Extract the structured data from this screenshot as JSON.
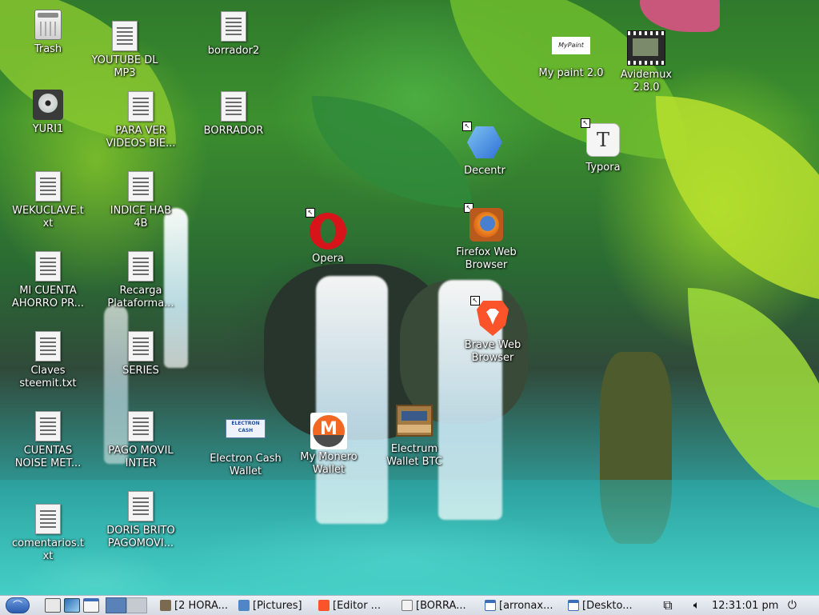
{
  "desktop": {
    "icons": [
      {
        "label": "Trash"
      },
      {
        "label": "YURI1"
      },
      {
        "label": "WEKUCLAVE.t\nxt"
      },
      {
        "label": "MI CUENTA\nAHORRO PR..."
      },
      {
        "label": "Claves\nsteemit.txt"
      },
      {
        "label": "CUENTAS\nNOISE MET..."
      },
      {
        "label": "comentarios.t\nxt"
      },
      {
        "label": "YOUTUBE DL\nMP3"
      },
      {
        "label": "PARA VER\nVIDEOS BIE..."
      },
      {
        "label": "INDICE HAB\n4B"
      },
      {
        "label": "Recarga\nPlataforma..."
      },
      {
        "label": "SERIES"
      },
      {
        "label": "PAGO MOVIL\nINTER"
      },
      {
        "label": "DORIS BRITO\nPAGOMOVI..."
      },
      {
        "label": "borrador2"
      },
      {
        "label": "BORRADOR"
      },
      {
        "label": "Electron Cash\nWallet",
        "logo_text": "ELECTRON\nCASH"
      },
      {
        "label": "Opera"
      },
      {
        "label": "My Monero\nWallet"
      },
      {
        "label": "Electrum\nWallet BTC"
      },
      {
        "label": "Decentr"
      },
      {
        "label": "Firefox Web\nBrowser"
      },
      {
        "label": "Brave Web\nBrowser"
      },
      {
        "label": "My paint 2.0",
        "logo_text": "MyPaint"
      },
      {
        "label": "Avidemux\n2.8.0"
      },
      {
        "label": "Typora",
        "glyph": "T"
      }
    ]
  },
  "taskbar": {
    "tasks": [
      {
        "label": "[2 HORA...",
        "icon": "gimp-icon"
      },
      {
        "label": "[Pictures]",
        "icon": "folder-icon"
      },
      {
        "label": "[Editor ...",
        "icon": "brave-icon"
      },
      {
        "label": "[BORRA...",
        "icon": "text-editor-icon"
      },
      {
        "label": "[arronax...",
        "icon": "window-icon"
      },
      {
        "label": "[Deskto...",
        "icon": "window-icon"
      }
    ],
    "clock": "12:31:01 pm",
    "colors": {
      "panel": "#dde2ea",
      "accent": "#3d6db5"
    }
  }
}
